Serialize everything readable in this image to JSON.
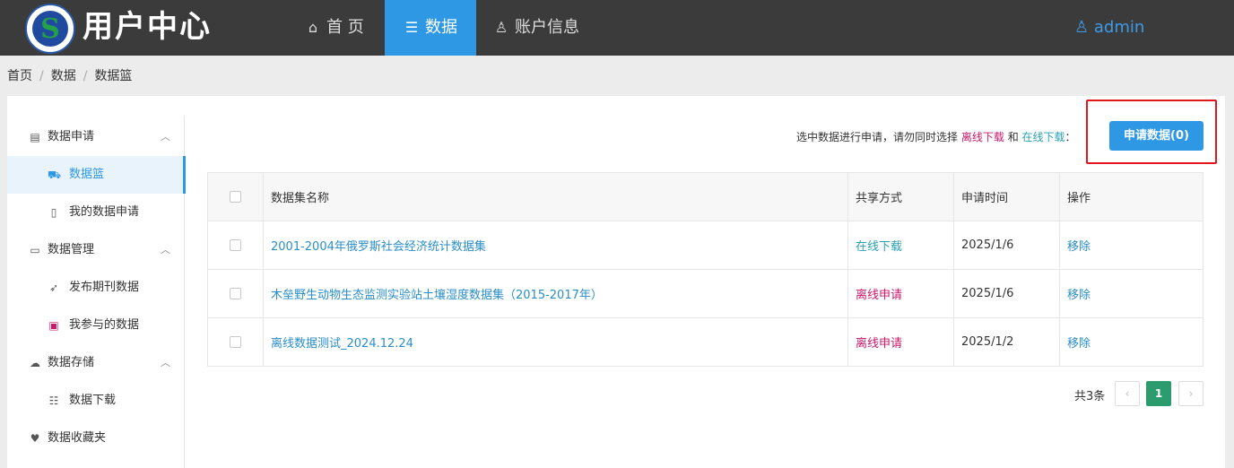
{
  "header": {
    "brand": "用户中心",
    "nav": [
      {
        "label": "首 页",
        "icon": "home-icon"
      },
      {
        "label": "数据",
        "icon": "list-icon"
      },
      {
        "label": "账户信息",
        "icon": "user-icon"
      }
    ],
    "user": "admin"
  },
  "breadcrumb": [
    "首页",
    "数据",
    "数据篮"
  ],
  "sidebar": {
    "groups": [
      {
        "label": "数据申请",
        "icon": "clipboard-icon",
        "items": [
          {
            "label": "数据篮",
            "icon": "cart-icon",
            "active": true
          },
          {
            "label": "我的数据申请",
            "icon": "document-icon"
          }
        ]
      },
      {
        "label": "数据管理",
        "icon": "monitor-icon",
        "items": [
          {
            "label": "发布期刊数据",
            "icon": "rocket-icon"
          },
          {
            "label": "我参与的数据",
            "icon": "wallet-icon"
          }
        ]
      },
      {
        "label": "数据存储",
        "icon": "cloud-icon",
        "items": [
          {
            "label": "数据下载",
            "icon": "file-list-icon"
          }
        ]
      },
      {
        "label": "数据收藏夹",
        "icon": "heart-icon",
        "items": []
      }
    ]
  },
  "notice": {
    "prefix": "选中数据进行申请，请勿同时选择",
    "offline": "离线下载",
    "and": "和",
    "online": "在线下载",
    "suffix": "："
  },
  "apply_button": "申请数据(0)",
  "table": {
    "columns": [
      "数据集名称",
      "共享方式",
      "申请时间",
      "操作"
    ],
    "rows": [
      {
        "name": "2001-2004年俄罗斯社会经济统计数据集",
        "share": "在线下载",
        "time": "2025/1/6",
        "action": "移除"
      },
      {
        "name": "木垒野生动物生态监测实验站土壤湿度数据集（2015-2017年）",
        "share": "离线申请",
        "time": "2025/1/6",
        "action": "移除"
      },
      {
        "name": "离线数据测试_2024.12.24",
        "share": "离线申请",
        "time": "2025/1/2",
        "action": "移除"
      }
    ]
  },
  "pager": {
    "total": "共3条",
    "current": "1",
    "prev": "‹",
    "next": "›"
  },
  "colors": {
    "topbar": "#3b3b3b",
    "accent": "#2f98e5",
    "offline": "#c7186a",
    "online": "#2aa0b4",
    "pager_active": "#2c9c6e",
    "highlight": "#e0181e"
  }
}
